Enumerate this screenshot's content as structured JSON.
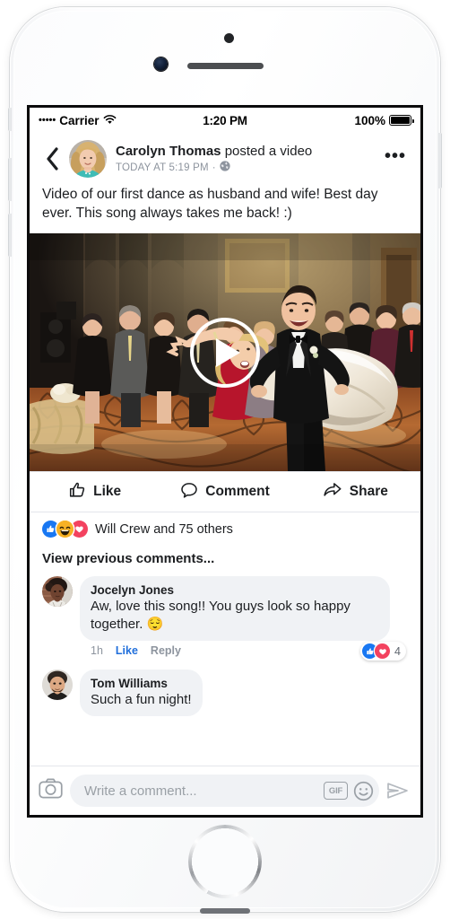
{
  "status_bar": {
    "carrier_dots": "•••••",
    "carrier": "Carrier",
    "wifi_icon": "wifi-icon",
    "time": "1:20 PM",
    "battery_percent": "100%",
    "battery_icon": "battery-full-icon"
  },
  "post": {
    "back_icon": "back-chevron-icon",
    "author": "Carolyn Thomas",
    "action_text": " posted a video",
    "timestamp": "TODAY AT 5:19 PM",
    "privacy_separator": "·",
    "privacy_icon": "globe-icon",
    "more_icon": "ellipsis-icon",
    "body": "Video of our first dance as husband and wife! Best day ever. This song always takes me back! :)",
    "play_icon": "play-button-icon"
  },
  "actions": {
    "like": "Like",
    "like_icon": "thumbs-up-outline-icon",
    "comment": "Comment",
    "comment_icon": "speech-bubble-outline-icon",
    "share": "Share",
    "share_icon": "share-arrow-icon"
  },
  "reactions": {
    "icons": [
      "like-reaction-icon",
      "haha-reaction-icon",
      "love-reaction-icon"
    ],
    "label": "Will Crew and 75 others",
    "colors": {
      "like": "#1877f2",
      "haha": "#f7b125",
      "love": "#f3425f"
    }
  },
  "comments_section": {
    "view_previous": "View previous comments...",
    "comments": [
      {
        "avatar": "jocelyn-jones-avatar",
        "name": "Jocelyn Jones",
        "text": "Aw, love this song!! You guys look so happy together. 😌",
        "time": "1h",
        "like": "Like",
        "reply": "Reply",
        "reaction_count": "4",
        "reaction_icons": [
          "like-reaction-icon",
          "love-reaction-icon"
        ]
      },
      {
        "avatar": "tom-williams-avatar",
        "name": "Tom Williams",
        "text": "Such a fun night!",
        "time": "",
        "like": "",
        "reply": "",
        "reaction_count": "",
        "reaction_icons": []
      }
    ]
  },
  "composer": {
    "camera_icon": "camera-icon",
    "placeholder": "Write a comment...",
    "value": "",
    "gif_label": "GIF",
    "emoji_icon": "smiley-face-icon",
    "send_icon": "send-arrow-icon"
  }
}
